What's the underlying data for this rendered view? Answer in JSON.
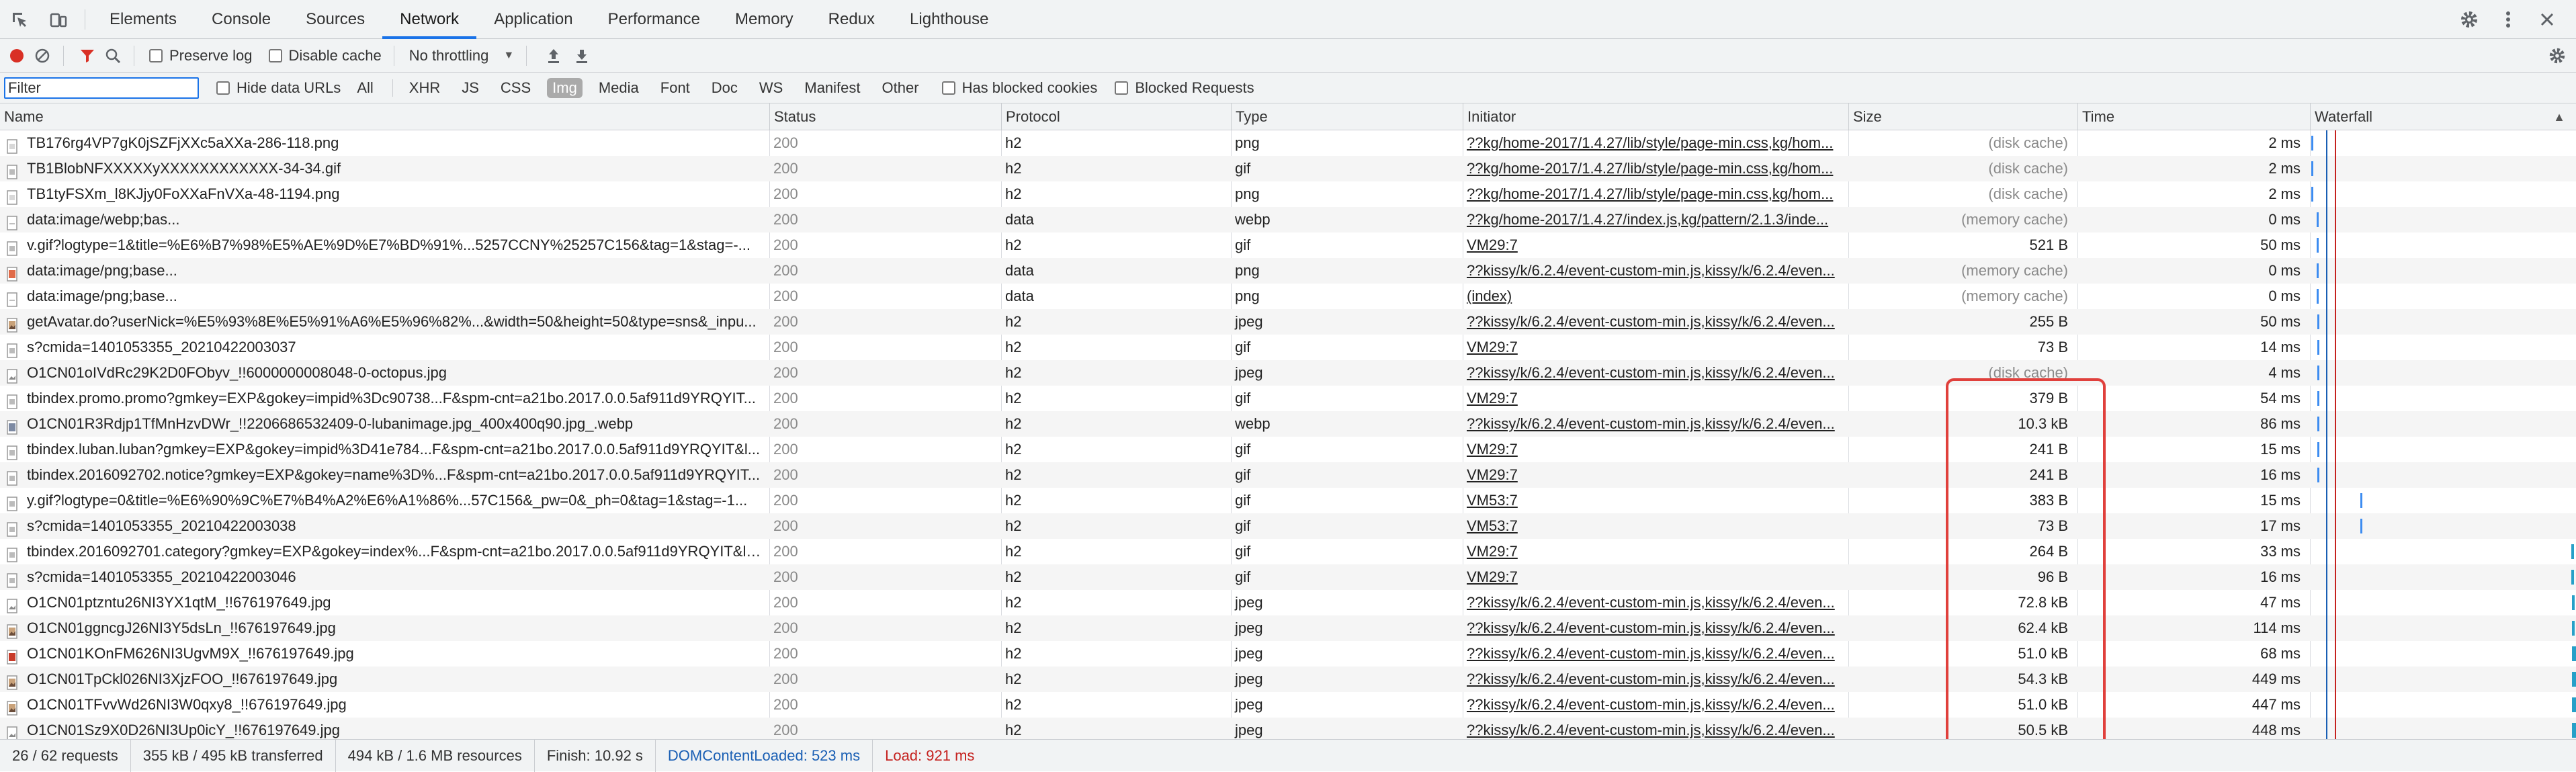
{
  "tabs": [
    {
      "label": "Elements",
      "active": false
    },
    {
      "label": "Console",
      "active": false
    },
    {
      "label": "Sources",
      "active": false
    },
    {
      "label": "Network",
      "active": true
    },
    {
      "label": "Application",
      "active": false
    },
    {
      "label": "Performance",
      "active": false
    },
    {
      "label": "Memory",
      "active": false
    },
    {
      "label": "Redux",
      "active": false
    },
    {
      "label": "Lighthouse",
      "active": false
    }
  ],
  "toolbar": {
    "preserve_log": "Preserve log",
    "disable_cache": "Disable cache",
    "throttling": "No throttling"
  },
  "filter": {
    "placeholder": "Filter",
    "hide_data_urls": "Hide data URLs",
    "types": [
      "All",
      "XHR",
      "JS",
      "CSS",
      "Img",
      "Media",
      "Font",
      "Doc",
      "WS",
      "Manifest",
      "Other"
    ],
    "active_type": "Img",
    "has_blocked_cookies": "Has blocked cookies",
    "blocked_requests": "Blocked Requests"
  },
  "columns": [
    "Name",
    "Status",
    "Protocol",
    "Type",
    "Initiator",
    "Size",
    "Time",
    "Waterfall"
  ],
  "rows": [
    {
      "name": "TB176rg4VP7gK0jSZFjXXc5aXXa-286-118.png",
      "status": "200",
      "protocol": "h2",
      "type": "png",
      "initiator": "??kg/home-2017/1.4.27/lib/style/page-min.css,kg/hom...",
      "size": "(disk cache)",
      "time": "2 ms",
      "icon": "png",
      "wf": 0.004
    },
    {
      "name": "TB1BlobNFXXXXXyXXXXXXXXXXXX-34-34.gif",
      "status": "200",
      "protocol": "h2",
      "type": "gif",
      "initiator": "??kg/home-2017/1.4.27/lib/style/page-min.css,kg/hom...",
      "size": "(disk cache)",
      "time": "2 ms",
      "icon": "gif",
      "wf": 0.004
    },
    {
      "name": "TB1tyFSXm_l8KJjy0FoXXaFnVXa-48-1194.png",
      "status": "200",
      "protocol": "h2",
      "type": "png",
      "initiator": "??kg/home-2017/1.4.27/lib/style/page-min.css,kg/hom...",
      "size": "(disk cache)",
      "time": "2 ms",
      "icon": "png",
      "wf": 0.004
    },
    {
      "name": "data:image/webp;bas...",
      "status": "200",
      "protocol": "data",
      "type": "webp",
      "initiator": "??kg/home-2017/1.4.27/index.js,kg/pattern/2.1.3/inde...",
      "size": "(memory cache)",
      "time": "0 ms",
      "icon": "data",
      "wf": 0.024
    },
    {
      "name": "v.gif?logtype=1&title=%E6%B7%98%E5%AE%9D%E7%BD%91%...5257CCNY%25257C156&tag=1&stag=-...",
      "status": "200",
      "protocol": "h2",
      "type": "gif",
      "initiator": "VM29:7",
      "size": "521 B",
      "time": "50 ms",
      "icon": "gif",
      "wf": 0.026
    },
    {
      "name": "data:image/png;base...",
      "status": "200",
      "protocol": "data",
      "type": "png",
      "initiator": "??kissy/k/6.2.4/event-custom-min.js,kissy/k/6.2.4/even...",
      "size": "(memory cache)",
      "time": "0 ms",
      "icon": "png-red",
      "wf": 0.026
    },
    {
      "name": "data:image/png;base...",
      "status": "200",
      "protocol": "data",
      "type": "png",
      "initiator": "(index)",
      "size": "(memory cache)",
      "time": "0 ms",
      "icon": "data",
      "wf": 0.026
    },
    {
      "name": "getAvatar.do?userNick=%E5%93%8E%E5%91%A6%E5%96%82%...&width=50&height=50&type=sns&_inpu...",
      "status": "200",
      "protocol": "h2",
      "type": "jpeg",
      "initiator": "??kissy/k/6.2.4/event-custom-min.js,kissy/k/6.2.4/even...",
      "size": "255 B",
      "time": "50 ms",
      "icon": "jpeg-color",
      "wf": 0.028
    },
    {
      "name": "s?cmida=1401053355_20210422003037",
      "status": "200",
      "protocol": "h2",
      "type": "gif",
      "initiator": "VM29:7",
      "size": "73 B",
      "time": "14 ms",
      "icon": "gif",
      "wf": 0.028
    },
    {
      "name": "O1CN01oIVdRc29K2D0FObyv_!!6000000008048-0-octopus.jpg",
      "status": "200",
      "protocol": "h2",
      "type": "jpeg",
      "initiator": "??kissy/k/6.2.4/event-custom-min.js,kissy/k/6.2.4/even...",
      "size": "(disk cache)",
      "time": "4 ms",
      "icon": "jpeg",
      "wf": 0.028
    },
    {
      "name": "tbindex.promo.promo?gmkey=EXP&gokey=impid%3Dc90738...F&spm-cnt=a21bo.2017.0.0.5af911d9YRQYIT...",
      "status": "200",
      "protocol": "h2",
      "type": "gif",
      "initiator": "VM29:7",
      "size": "379 B",
      "time": "54 ms",
      "icon": "gif",
      "wf": 0.028
    },
    {
      "name": "O1CN01R3Rdjp1TfMnHzvDWr_!!2206686532409-0-lubanimage.jpg_400x400q90.jpg_.webp",
      "status": "200",
      "protocol": "h2",
      "type": "webp",
      "initiator": "??kissy/k/6.2.4/event-custom-min.js,kissy/k/6.2.4/even...",
      "size": "10.3 kB",
      "time": "86 ms",
      "icon": "webp",
      "wf": 0.028
    },
    {
      "name": "tbindex.luban.luban?gmkey=EXP&gokey=impid%3D41e784...F&spm-cnt=a21bo.2017.0.0.5af911d9YRQYIT&l...",
      "status": "200",
      "protocol": "h2",
      "type": "gif",
      "initiator": "VM29:7",
      "size": "241 B",
      "time": "15 ms",
      "icon": "gif",
      "wf": 0.028
    },
    {
      "name": "tbindex.2016092702.notice?gmkey=EXP&gokey=name%3D%...F&spm-cnt=a21bo.2017.0.0.5af911d9YRQYIT...",
      "status": "200",
      "protocol": "h2",
      "type": "gif",
      "initiator": "VM29:7",
      "size": "241 B",
      "time": "16 ms",
      "icon": "gif",
      "wf": 0.028
    },
    {
      "name": "y.gif?logtype=0&title=%E6%90%9C%E7%B4%A2%E6%A1%86%...57C156&_pw=0&_ph=0&tag=1&stag=-1...",
      "status": "200",
      "protocol": "h2",
      "type": "gif",
      "initiator": "VM53:7",
      "size": "383 B",
      "time": "15 ms",
      "icon": "gif",
      "wf": 0.19
    },
    {
      "name": "s?cmida=1401053355_20210422003038",
      "status": "200",
      "protocol": "h2",
      "type": "gif",
      "initiator": "VM53:7",
      "size": "73 B",
      "time": "17 ms",
      "icon": "gif",
      "wf": 0.19
    },
    {
      "name": "tbindex.2016092701.category?gmkey=EXP&gokey=index%...F&spm-cnt=a21bo.2017.0.0.5af911d9YRQYIT&lo...",
      "status": "200",
      "protocol": "h2",
      "type": "gif",
      "initiator": "VM29:7",
      "size": "264 B",
      "time": "33 ms",
      "icon": "gif",
      "wf": 0.982
    },
    {
      "name": "s?cmida=1401053355_20210422003046",
      "status": "200",
      "protocol": "h2",
      "type": "gif",
      "initiator": "VM29:7",
      "size": "96 B",
      "time": "16 ms",
      "icon": "gif",
      "wf": 0.982
    },
    {
      "name": "O1CN01ptzntu26NI3YX1qtM_!!676197649.jpg",
      "status": "200",
      "protocol": "h2",
      "type": "jpeg",
      "initiator": "??kissy/k/6.2.4/event-custom-min.js,kissy/k/6.2.4/even...",
      "size": "72.8 kB",
      "time": "47 ms",
      "icon": "jpeg",
      "wf": 0.985
    },
    {
      "name": "O1CN01ggncgJ26NI3Y5dsLn_!!676197649.jpg",
      "status": "200",
      "protocol": "h2",
      "type": "jpeg",
      "initiator": "??kissy/k/6.2.4/event-custom-min.js,kissy/k/6.2.4/even...",
      "size": "62.4 kB",
      "time": "114 ms",
      "icon": "jpeg-color",
      "wf": 0.985
    },
    {
      "name": "O1CN01KOnFM626NI3UgvM9X_!!676197649.jpg",
      "status": "200",
      "protocol": "h2",
      "type": "jpeg",
      "initiator": "??kissy/k/6.2.4/event-custom-min.js,kissy/k/6.2.4/even...",
      "size": "51.0 kB",
      "time": "68 ms",
      "icon": "jpeg-red",
      "wf": 0.985
    },
    {
      "name": "O1CN01TpCkl026NI3XjzFOO_!!676197649.jpg",
      "status": "200",
      "protocol": "h2",
      "type": "jpeg",
      "initiator": "??kissy/k/6.2.4/event-custom-min.js,kissy/k/6.2.4/even...",
      "size": "54.3 kB",
      "time": "449 ms",
      "icon": "jpeg-color",
      "wf": 0.985
    },
    {
      "name": "O1CN01TFvvWd26NI3W0qxy8_!!676197649.jpg",
      "status": "200",
      "protocol": "h2",
      "type": "jpeg",
      "initiator": "??kissy/k/6.2.4/event-custom-min.js,kissy/k/6.2.4/even...",
      "size": "51.0 kB",
      "time": "447 ms",
      "icon": "jpeg-color",
      "wf": 0.985
    },
    {
      "name": "O1CN01Sz9X0D26NI3Up0icY_!!676197649.jpg",
      "status": "200",
      "protocol": "h2",
      "type": "jpeg",
      "initiator": "??kissy/k/6.2.4/event-custom-min.js,kissy/k/6.2.4/even...",
      "size": "50.5 kB",
      "time": "448 ms",
      "icon": "jpeg",
      "wf": 0.985
    }
  ],
  "status_bar": {
    "requests": "26 / 62 requests",
    "transferred": "355 kB / 495 kB transferred",
    "resources": "494 kB / 1.6 MB resources",
    "finish": "Finish: 10.92 s",
    "dcl": "DOMContentLoaded: 523 ms",
    "load": "Load: 921 ms"
  },
  "colors": {
    "accent": "#1a73e8",
    "record": "#d93025",
    "highlight": "#e0403c",
    "dcl": "#1a5fb4",
    "load": "#c5221f"
  }
}
